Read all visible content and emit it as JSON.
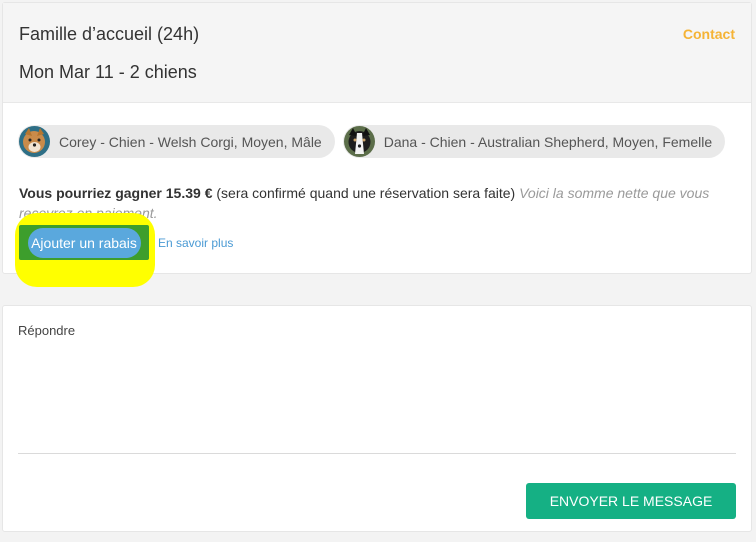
{
  "booking": {
    "service_title": "Famille d’accueil (24h)",
    "summary": "Mon Mar 11 - 2 chiens",
    "contact_label": "Contact"
  },
  "pets": [
    {
      "label": "Corey - Chien - Welsh Corgi, Moyen, Mâle"
    },
    {
      "label": "Dana - Chien - Australian Shepherd, Moyen, Femelle"
    }
  ],
  "earnings": {
    "lead": "Vous pourriez gagner",
    "amount": "15.39 €",
    "confirm_note": "(sera confirmé quand une réservation sera faite)",
    "net_note": "Voici la somme nette que vous recevrez en paiement."
  },
  "discount": {
    "button_label": "Ajouter un rabais",
    "learn_more": "En savoir plus"
  },
  "reply": {
    "label": "Répondre",
    "send_label": "ENVOYER LE MESSAGE"
  },
  "colors": {
    "accent_contact": "#f5b335",
    "send_button": "#15b084",
    "discount_button": "#3d9e2c",
    "highlight": "#ffff00",
    "link": "#4a9ad4"
  }
}
